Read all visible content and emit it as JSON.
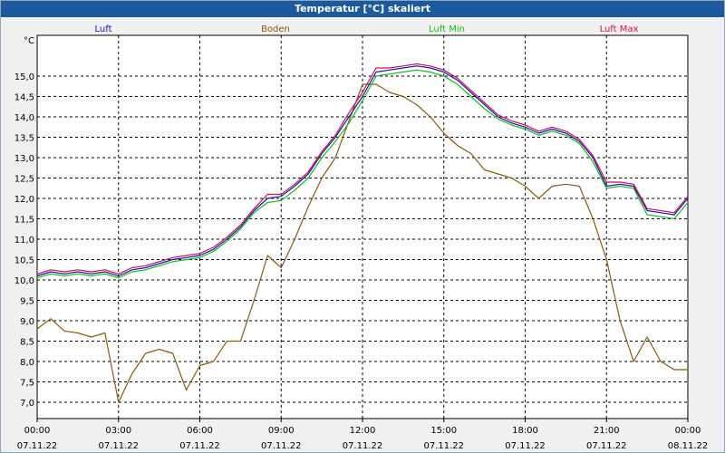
{
  "window": {
    "title": "Temperatur [°C] skaliert"
  },
  "chart_data": {
    "type": "line",
    "title": "Temperatur [°C] skaliert",
    "ylabel": "°C",
    "xlabel": "",
    "ylim": [
      6.6,
      16.0
    ],
    "xlim": [
      0,
      24
    ],
    "grid": true,
    "legend_position": "top",
    "y_ticks": [
      "7,0",
      "7,5",
      "8,0",
      "8,5",
      "9,0",
      "9,5",
      "10,0",
      "10,5",
      "11,0",
      "11,5",
      "12,0",
      "12,5",
      "13,0",
      "13,5",
      "14,0",
      "14,5",
      "15,0"
    ],
    "x_ticks": [
      {
        "time": "00:00",
        "date": "07.11.22"
      },
      {
        "time": "03:00",
        "date": "07.11.22"
      },
      {
        "time": "06:00",
        "date": "07.11.22"
      },
      {
        "time": "09:00",
        "date": "07.11.22"
      },
      {
        "time": "12:00",
        "date": "07.11.22"
      },
      {
        "time": "15:00",
        "date": "07.11.22"
      },
      {
        "time": "18:00",
        "date": "07.11.22"
      },
      {
        "time": "21:00",
        "date": "07.11.22"
      },
      {
        "time": "00:00",
        "date": "08.11.22"
      }
    ],
    "x": [
      0,
      0.5,
      1,
      1.5,
      2,
      2.5,
      3,
      3.5,
      4,
      4.5,
      5,
      5.5,
      6,
      6.5,
      7,
      7.5,
      8,
      8.5,
      9,
      9.5,
      10,
      10.5,
      11,
      11.5,
      12,
      12.5,
      13,
      13.5,
      14,
      14.5,
      15,
      15.5,
      16,
      16.5,
      17,
      17.5,
      18,
      18.5,
      19,
      19.5,
      20,
      20.5,
      21,
      21.5,
      22,
      22.5,
      23,
      23.5,
      24
    ],
    "series": [
      {
        "name": "Luft",
        "color": "#1515b0",
        "values": [
          10.1,
          10.2,
          10.15,
          10.2,
          10.15,
          10.2,
          10.1,
          10.25,
          10.3,
          10.4,
          10.5,
          10.55,
          10.6,
          10.75,
          11.0,
          11.3,
          11.7,
          12.0,
          12.05,
          12.3,
          12.6,
          13.1,
          13.5,
          14.0,
          14.5,
          15.1,
          15.15,
          15.2,
          15.25,
          15.2,
          15.1,
          14.9,
          14.6,
          14.3,
          14.0,
          13.85,
          13.75,
          13.6,
          13.7,
          13.6,
          13.4,
          13.0,
          12.3,
          12.35,
          12.3,
          11.7,
          11.65,
          11.6,
          12.0
        ]
      },
      {
        "name": "Boden",
        "color": "#8a5a10",
        "values": [
          8.8,
          9.05,
          8.75,
          8.7,
          8.6,
          8.7,
          7.0,
          7.7,
          8.2,
          8.3,
          8.2,
          7.3,
          7.9,
          8.0,
          8.5,
          8.5,
          9.5,
          10.6,
          10.3,
          11.0,
          11.8,
          12.5,
          13.0,
          13.9,
          14.8,
          14.8,
          14.6,
          14.5,
          14.3,
          14.0,
          13.6,
          13.3,
          13.1,
          12.7,
          12.6,
          12.5,
          12.3,
          12.0,
          12.3,
          12.35,
          12.3,
          11.5,
          10.5,
          9.0,
          8.0,
          8.6,
          8.0,
          7.8,
          7.8
        ]
      },
      {
        "name": "Luft Min",
        "color": "#10c010",
        "values": [
          10.05,
          10.15,
          10.1,
          10.15,
          10.1,
          10.15,
          10.05,
          10.2,
          10.25,
          10.35,
          10.45,
          10.5,
          10.55,
          10.7,
          10.95,
          11.25,
          11.65,
          11.9,
          11.95,
          12.2,
          12.5,
          13.0,
          13.4,
          13.85,
          14.4,
          15.0,
          15.05,
          15.1,
          15.15,
          15.1,
          15.0,
          14.8,
          14.5,
          14.2,
          13.95,
          13.8,
          13.7,
          13.55,
          13.65,
          13.55,
          13.35,
          12.9,
          12.25,
          12.3,
          12.25,
          11.6,
          11.55,
          11.5,
          11.9
        ]
      },
      {
        "name": "Luft Max",
        "color": "#d01050",
        "values": [
          10.15,
          10.25,
          10.2,
          10.25,
          10.2,
          10.25,
          10.15,
          10.3,
          10.35,
          10.45,
          10.55,
          10.6,
          10.65,
          10.8,
          11.05,
          11.35,
          11.75,
          12.1,
          12.1,
          12.35,
          12.65,
          13.15,
          13.55,
          14.1,
          14.6,
          15.2,
          15.2,
          15.25,
          15.3,
          15.25,
          15.15,
          14.95,
          14.65,
          14.35,
          14.05,
          13.9,
          13.8,
          13.65,
          13.75,
          13.65,
          13.45,
          13.05,
          12.4,
          12.4,
          12.35,
          11.75,
          11.7,
          11.65,
          12.05
        ]
      }
    ]
  }
}
